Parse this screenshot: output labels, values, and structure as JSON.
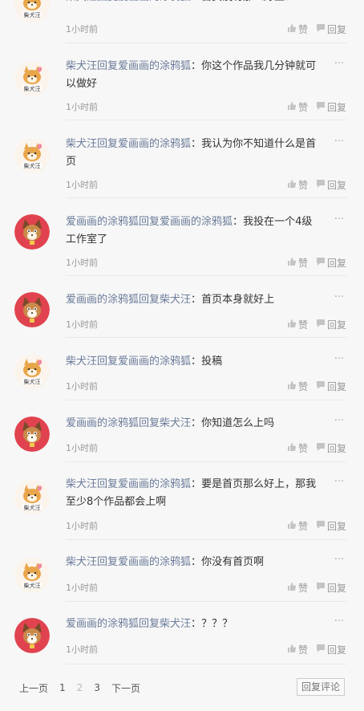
{
  "comments": [
    {
      "user": "柴犬汪",
      "verb": "回复",
      "target": "爱画画的涂鸦狐",
      "content": "首页没有那么好上！",
      "time": "1小时前",
      "avatar": "shiba"
    },
    {
      "user": "柴犬汪",
      "verb": "回复",
      "target": "爱画画的涂鸦狐",
      "content": "你这个作品我几分钟就可以做好",
      "time": "1小时前",
      "avatar": "shiba"
    },
    {
      "user": "柴犬汪",
      "verb": "回复",
      "target": "爱画画的涂鸦狐",
      "content": "我认为你不知道什么是首页",
      "time": "1小时前",
      "avatar": "shiba"
    },
    {
      "user": "爱画画的涂鸦狐",
      "verb": "回复",
      "target": "爱画画的涂鸦狐",
      "content": "我投在一个4级工作室了",
      "time": "1小时前",
      "avatar": "fox"
    },
    {
      "user": "爱画画的涂鸦狐",
      "verb": "回复",
      "target": "柴犬汪",
      "content": "首页本身就好上",
      "time": "1小时前",
      "avatar": "fox"
    },
    {
      "user": "柴犬汪",
      "verb": "回复",
      "target": "爱画画的涂鸦狐",
      "content": "投稿",
      "time": "1小时前",
      "avatar": "shiba"
    },
    {
      "user": "爱画画的涂鸦狐",
      "verb": "回复",
      "target": "柴犬汪",
      "content": "你知道怎么上吗",
      "time": "1小时前",
      "avatar": "fox"
    },
    {
      "user": "柴犬汪",
      "verb": "回复",
      "target": "爱画画的涂鸦狐",
      "content": "要是首页那么好上，那我至少8个作品都会上啊",
      "time": "1小时前",
      "avatar": "shiba"
    },
    {
      "user": "柴犬汪",
      "verb": "回复",
      "target": "爱画画的涂鸦狐",
      "content": "你没有首页啊",
      "time": "1小时前",
      "avatar": "shiba"
    },
    {
      "user": "爱画画的涂鸦狐",
      "verb": "回复",
      "target": "柴犬汪",
      "content": "？？？",
      "time": "1小时前",
      "avatar": "fox"
    }
  ],
  "labels": {
    "like": "赞",
    "reply": "回复",
    "more": "···"
  },
  "pagination": {
    "prev": "上一页",
    "pages": [
      "1",
      "2",
      "3"
    ],
    "current": "2",
    "next": "下一页"
  },
  "reply_comment_button": "回复评论",
  "icons": {
    "like": "thumbs-up-icon",
    "reply": "speech-bubble-icon",
    "more": "more-dots-icon"
  }
}
